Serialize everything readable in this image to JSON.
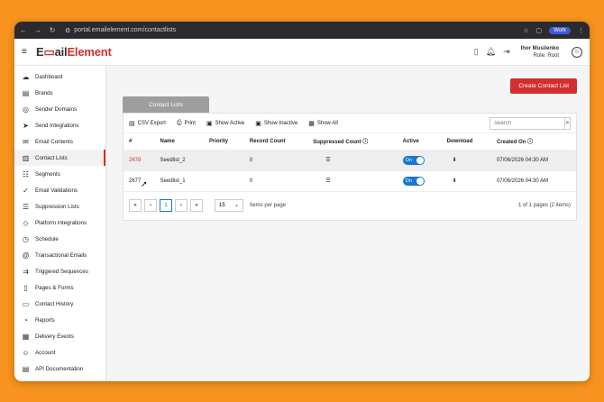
{
  "browser": {
    "url": "portal.emailelement.com/contactlists",
    "profile": "Work"
  },
  "header": {
    "logo_prefix": "E",
    "logo_mid": "ail",
    "logo_suffix": "Element",
    "user_name": "Ihor Musiienko",
    "user_role": "Role: Root"
  },
  "sidebar": {
    "items": [
      {
        "label": "Dashboard",
        "icon": "cloud-icon"
      },
      {
        "label": "Brands",
        "icon": "brands-icon"
      },
      {
        "label": "Sender Domains",
        "icon": "globe-icon"
      },
      {
        "label": "Send Integrations",
        "icon": "send-icon"
      },
      {
        "label": "Email Contents",
        "icon": "mail-icon"
      },
      {
        "label": "Contact Lists",
        "icon": "book-icon"
      },
      {
        "label": "Segments",
        "icon": "segments-icon"
      },
      {
        "label": "Email Validations",
        "icon": "check-circle-icon"
      },
      {
        "label": "Suppression Lists",
        "icon": "suppression-icon"
      },
      {
        "label": "Platform Integrations",
        "icon": "puzzle-icon"
      },
      {
        "label": "Schedule",
        "icon": "clock-icon"
      },
      {
        "label": "Transactional Emails",
        "icon": "at-icon"
      },
      {
        "label": "Triggered Sequences",
        "icon": "sequence-icon"
      },
      {
        "label": "Pages & Forms",
        "icon": "page-icon"
      },
      {
        "label": "Contact History",
        "icon": "history-icon"
      },
      {
        "label": "Reports",
        "icon": "report-icon"
      },
      {
        "label": "Delivery Events",
        "icon": "chart-icon"
      },
      {
        "label": "Account",
        "icon": "account-icon"
      },
      {
        "label": "API Documentation",
        "icon": "doc-icon"
      }
    ]
  },
  "main": {
    "create_button": "Create Contact List",
    "tab_label": "Contact Lists",
    "toolbar": {
      "csv_export": "CSV Export",
      "print": "Print",
      "show_active": "Show Active",
      "show_inactive": "Show Inactive",
      "show_all": "Show All",
      "search_placeholder": "Search"
    },
    "columns": [
      "#",
      "Name",
      "Priority",
      "Record Count",
      "Suppressed Count",
      "Active",
      "Download",
      "Created On"
    ],
    "rows": [
      {
        "id": "2678",
        "name": "Seedlist_2",
        "priority": "",
        "record_count": "0",
        "active": "On",
        "created_on": "07/06/2026 04:30 AM"
      },
      {
        "id": "2677",
        "name": "Seedlist_1",
        "priority": "",
        "record_count": "0",
        "active": "On",
        "created_on": "07/06/2026 04:30 AM"
      }
    ],
    "pager": {
      "first": "«",
      "prev": "‹",
      "current": "1",
      "next": "›",
      "last": "»",
      "page_size": "15",
      "page_size_label": "Items per page",
      "info": "1 of 1 pages (2 items)"
    }
  }
}
